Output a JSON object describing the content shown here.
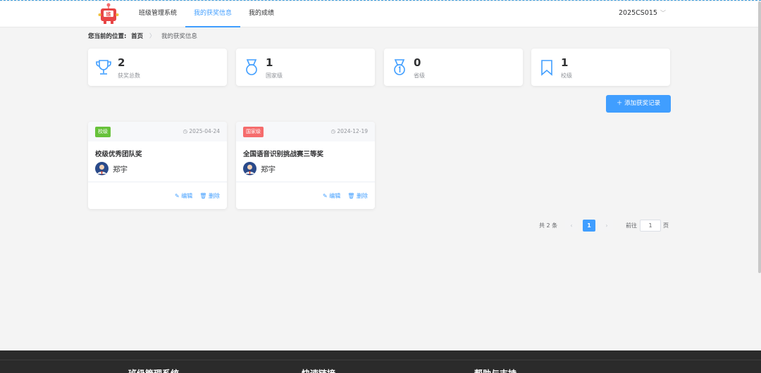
{
  "header": {
    "nav": [
      "班级管理系统",
      "我的获奖信息",
      "我的成绩"
    ],
    "active_nav": 1,
    "user": "2025CS015",
    "user_caret": "﹀",
    "logo_char": "班"
  },
  "breadcrumb": {
    "label": "您当前的位置:",
    "home": "首页",
    "sep": "〉",
    "current": "我的获奖信息"
  },
  "stats": [
    {
      "value": "2",
      "label": "获奖总数",
      "icon": "trophy-icon"
    },
    {
      "value": "1",
      "label": "国家级",
      "icon": "medal-icon"
    },
    {
      "value": "0",
      "label": "省级",
      "icon": "medal-one-icon"
    },
    {
      "value": "1",
      "label": "校级",
      "icon": "bookmark-icon"
    }
  ],
  "add_button": "＋ 添加获奖记录",
  "awards": [
    {
      "level": "校级",
      "level_color": "#67c23a",
      "date": "◷ 2025-04-24",
      "title": "校级优秀团队奖",
      "name": "郑宇",
      "edit": "✎ 编辑",
      "delete": "🗑 删除"
    },
    {
      "level": "国家级",
      "level_color": "#f56c6c",
      "date": "◷ 2024-12-19",
      "title": "全国语音识别挑战赛三等奖",
      "name": "郑宇",
      "edit": "✎ 编辑",
      "delete": "🗑 删除"
    }
  ],
  "pagination": {
    "total": "共 2 条",
    "prev": "‹",
    "page": "1",
    "next": "›",
    "goto_label": "前往",
    "goto_value": "1",
    "unit": "页"
  },
  "footer": {
    "headings": [
      "班级管理系统",
      "快速链接",
      "帮助与支持"
    ]
  },
  "colors": {
    "primary": "#409eff",
    "school_tag": "#67c23a",
    "national_tag": "#f56c6c"
  }
}
